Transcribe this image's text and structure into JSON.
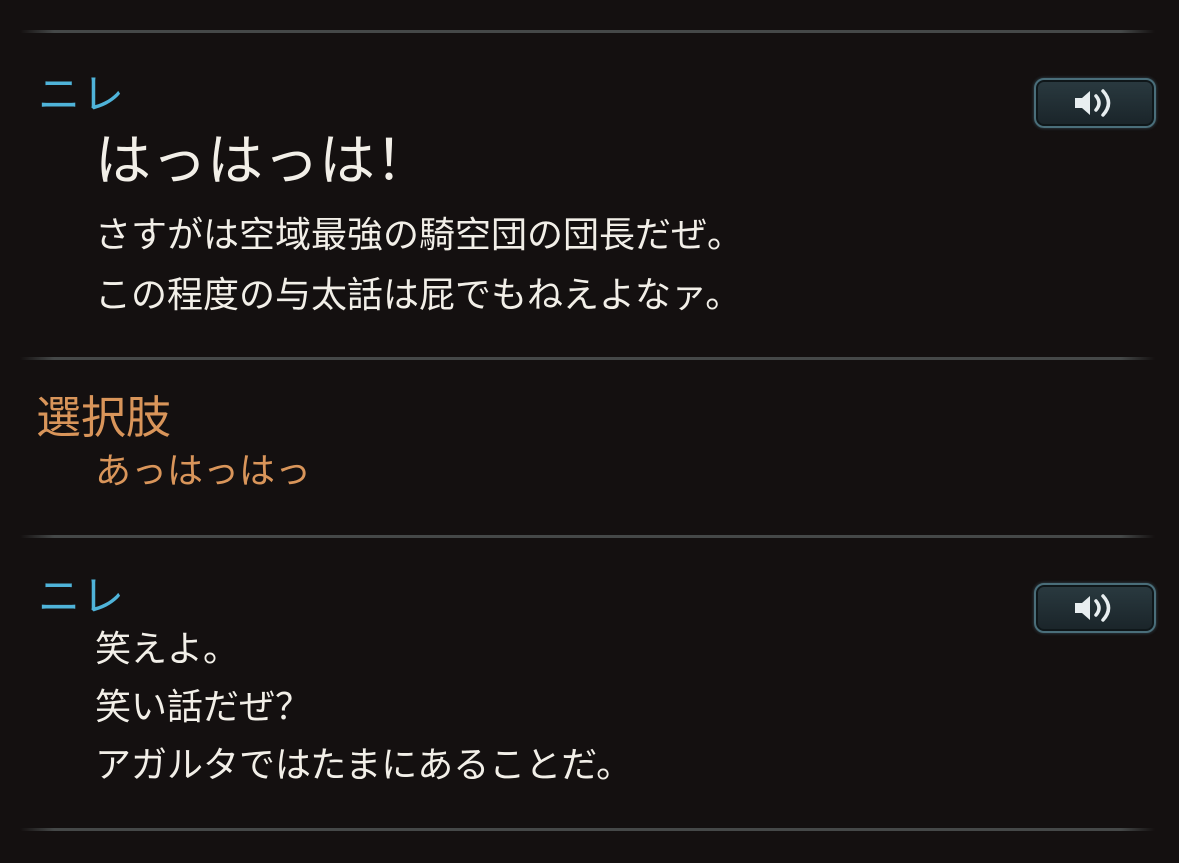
{
  "entries": [
    {
      "speaker": "ニレ",
      "headline": "はっはっは！",
      "lines": [
        "さすがは空域最強の騎空団の団長だぜ。",
        "この程度の与太話は屁でもねえよなァ。"
      ],
      "voice_icon": "speaker-icon"
    },
    {
      "choice_label": "選択肢",
      "choice_text": "あっはっはっ"
    },
    {
      "speaker": "ニレ",
      "lines": [
        "笑えよ。",
        "笑い話だぜ？",
        "アガルタではたまにあることだ。"
      ],
      "voice_icon": "speaker-icon"
    }
  ],
  "colors": {
    "speaker": "#4fb3d9",
    "choice": "#d9955a",
    "text": "#f2efe8",
    "background": "#141010"
  }
}
